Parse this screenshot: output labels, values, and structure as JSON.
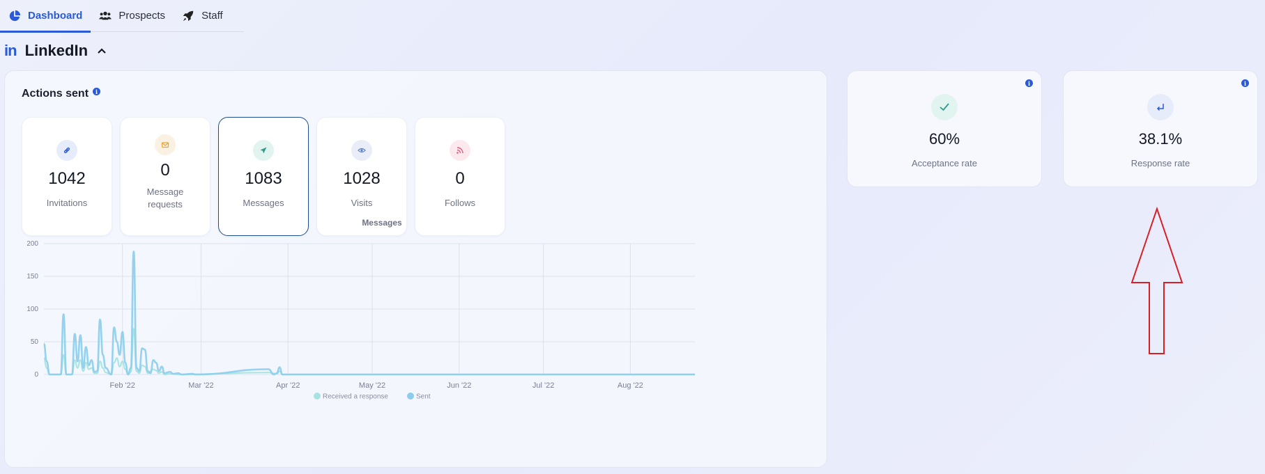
{
  "nav": {
    "tabs": [
      {
        "label": "Dashboard",
        "icon": "pie-chart-icon",
        "active": true
      },
      {
        "label": "Prospects",
        "icon": "users-icon",
        "active": false
      },
      {
        "label": "Staff",
        "icon": "rocket-icon",
        "active": false
      }
    ]
  },
  "section": {
    "logo": "in",
    "title": "LinkedIn"
  },
  "actions": {
    "title": "Actions sent",
    "stats": [
      {
        "value": "1042",
        "label": "Invitations",
        "icon": "link-icon",
        "icon_color": "#2a5ad8",
        "icon_bg": "#e7ecfb"
      },
      {
        "value": "0",
        "label": "Message requests",
        "icon": "envelope-icon",
        "icon_color": "#e8a53a",
        "icon_bg": "#fbf1e2"
      },
      {
        "value": "1083",
        "label": "Messages",
        "icon": "send-icon",
        "icon_color": "#2f9a8b",
        "icon_bg": "#e2f4ef"
      },
      {
        "value": "1028",
        "label": "Visits",
        "icon": "eye-icon",
        "icon_color": "#5b80c9",
        "icon_bg": "#e8edf7"
      },
      {
        "value": "0",
        "label": "Follows",
        "icon": "rss-icon",
        "icon_color": "#e0607a",
        "icon_bg": "#fbe9ee"
      }
    ]
  },
  "rates": [
    {
      "value": "60%",
      "label": "Acceptance rate",
      "icon": "check-icon",
      "icon_color": "#2f9a8b",
      "icon_bg": "#e2f4ef"
    },
    {
      "value": "38.1%",
      "label": "Response rate",
      "icon": "reply-arrow-icon",
      "icon_color": "#2a5ad8",
      "icon_bg": "#e7ecfb"
    }
  ],
  "chart_data": {
    "type": "line",
    "title": "Messages",
    "x_tick_labels": [
      "Feb '22",
      "Mar '22",
      "Apr '22",
      "May '22",
      "Jun '22",
      "Jul '22",
      "Aug '22"
    ],
    "x_tick_dates": [
      "2022-02-01",
      "2022-03-01",
      "2022-04-01",
      "2022-05-01",
      "2022-06-01",
      "2022-07-01",
      "2022-08-01"
    ],
    "xlim": [
      "2022-01-04",
      "2022-08-24"
    ],
    "ylim": [
      0,
      200
    ],
    "y_ticks": [
      0,
      50,
      100,
      150,
      200
    ],
    "legend_position": "bottom",
    "grid": true,
    "series": [
      {
        "name": "Received a response",
        "color": "#a8e3e0",
        "points": [
          [
            "2022-01-04",
            25
          ],
          [
            "2022-01-05",
            10
          ],
          [
            "2022-01-06",
            0
          ],
          [
            "2022-01-10",
            0
          ],
          [
            "2022-01-11",
            30
          ],
          [
            "2022-01-12",
            0
          ],
          [
            "2022-01-14",
            0
          ],
          [
            "2022-01-15",
            22
          ],
          [
            "2022-01-16",
            10
          ],
          [
            "2022-01-17",
            22
          ],
          [
            "2022-01-18",
            5
          ],
          [
            "2022-01-19",
            18
          ],
          [
            "2022-01-20",
            8
          ],
          [
            "2022-01-21",
            10
          ],
          [
            "2022-01-22",
            2
          ],
          [
            "2022-01-23",
            2
          ],
          [
            "2022-01-24",
            20
          ],
          [
            "2022-01-25",
            10
          ],
          [
            "2022-01-26",
            3
          ],
          [
            "2022-01-28",
            0
          ],
          [
            "2022-01-29",
            18
          ],
          [
            "2022-01-30",
            25
          ],
          [
            "2022-01-31",
            12
          ],
          [
            "2022-02-01",
            20
          ],
          [
            "2022-02-02",
            8
          ],
          [
            "2022-02-03",
            0
          ],
          [
            "2022-02-04",
            4
          ],
          [
            "2022-02-05",
            70
          ],
          [
            "2022-02-06",
            5
          ],
          [
            "2022-02-07",
            2
          ],
          [
            "2022-02-08",
            14
          ],
          [
            "2022-02-09",
            12
          ],
          [
            "2022-02-10",
            2
          ],
          [
            "2022-02-12",
            8
          ],
          [
            "2022-02-13",
            6
          ],
          [
            "2022-02-14",
            2
          ],
          [
            "2022-02-15",
            4
          ],
          [
            "2022-02-16",
            0
          ],
          [
            "2022-02-18",
            1
          ],
          [
            "2022-02-21",
            0
          ],
          [
            "2022-03-25",
            3
          ],
          [
            "2022-03-28",
            1
          ],
          [
            "2022-03-29",
            5
          ],
          [
            "2022-03-30",
            0
          ],
          [
            "2022-08-24",
            0
          ]
        ]
      },
      {
        "name": "Sent",
        "color": "#8ccdec",
        "points": [
          [
            "2022-01-04",
            47
          ],
          [
            "2022-01-05",
            20
          ],
          [
            "2022-01-06",
            0
          ],
          [
            "2022-01-10",
            0
          ],
          [
            "2022-01-11",
            92
          ],
          [
            "2022-01-12",
            0
          ],
          [
            "2022-01-14",
            0
          ],
          [
            "2022-01-15",
            62
          ],
          [
            "2022-01-16",
            20
          ],
          [
            "2022-01-17",
            60
          ],
          [
            "2022-01-18",
            10
          ],
          [
            "2022-01-19",
            42
          ],
          [
            "2022-01-20",
            14
          ],
          [
            "2022-01-21",
            22
          ],
          [
            "2022-01-22",
            4
          ],
          [
            "2022-01-23",
            5
          ],
          [
            "2022-01-24",
            84
          ],
          [
            "2022-01-25",
            30
          ],
          [
            "2022-01-26",
            10
          ],
          [
            "2022-01-28",
            0
          ],
          [
            "2022-01-29",
            72
          ],
          [
            "2022-01-30",
            50
          ],
          [
            "2022-01-31",
            30
          ],
          [
            "2022-02-01",
            65
          ],
          [
            "2022-02-02",
            18
          ],
          [
            "2022-02-03",
            0
          ],
          [
            "2022-02-04",
            10
          ],
          [
            "2022-02-05",
            188
          ],
          [
            "2022-02-06",
            10
          ],
          [
            "2022-02-07",
            5
          ],
          [
            "2022-02-08",
            40
          ],
          [
            "2022-02-09",
            38
          ],
          [
            "2022-02-10",
            5
          ],
          [
            "2022-02-11",
            2
          ],
          [
            "2022-02-12",
            22
          ],
          [
            "2022-02-13",
            18
          ],
          [
            "2022-02-14",
            5
          ],
          [
            "2022-02-15",
            12
          ],
          [
            "2022-02-16",
            2
          ],
          [
            "2022-02-18",
            4
          ],
          [
            "2022-02-19",
            1
          ],
          [
            "2022-02-21",
            2
          ],
          [
            "2022-02-22",
            0
          ],
          [
            "2022-02-26",
            1
          ],
          [
            "2022-02-27",
            0
          ],
          [
            "2022-03-25",
            8
          ],
          [
            "2022-03-27",
            0
          ],
          [
            "2022-03-28",
            2
          ],
          [
            "2022-03-29",
            11
          ],
          [
            "2022-03-30",
            0
          ],
          [
            "2022-08-24",
            0
          ]
        ]
      }
    ]
  }
}
